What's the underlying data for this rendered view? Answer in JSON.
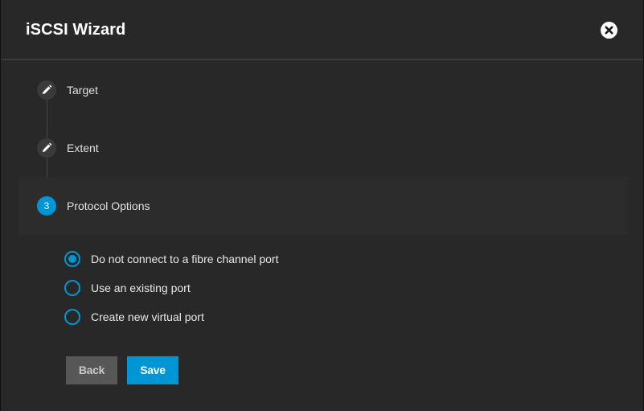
{
  "dialog": {
    "title": "iSCSI Wizard",
    "close_icon": "close-circle-icon"
  },
  "steps": [
    {
      "label": "Target",
      "marker": "edit-pencil-icon",
      "state": "completed"
    },
    {
      "label": "Extent",
      "marker": "edit-pencil-icon",
      "state": "completed"
    },
    {
      "label": "Protocol Options",
      "marker": "3",
      "state": "active"
    }
  ],
  "protocol_options": {
    "selected": "Do not connect to a fibre channel port",
    "options": [
      {
        "label": "Do not connect to a fibre channel port",
        "checked": true
      },
      {
        "label": "Use an existing port",
        "checked": false
      },
      {
        "label": "Create new virtual port",
        "checked": false
      }
    ]
  },
  "actions": {
    "back_label": "Back",
    "save_label": "Save"
  },
  "colors": {
    "accent": "#0095d5",
    "dialog_bg": "#282828",
    "back_button_bg": "#575757"
  }
}
